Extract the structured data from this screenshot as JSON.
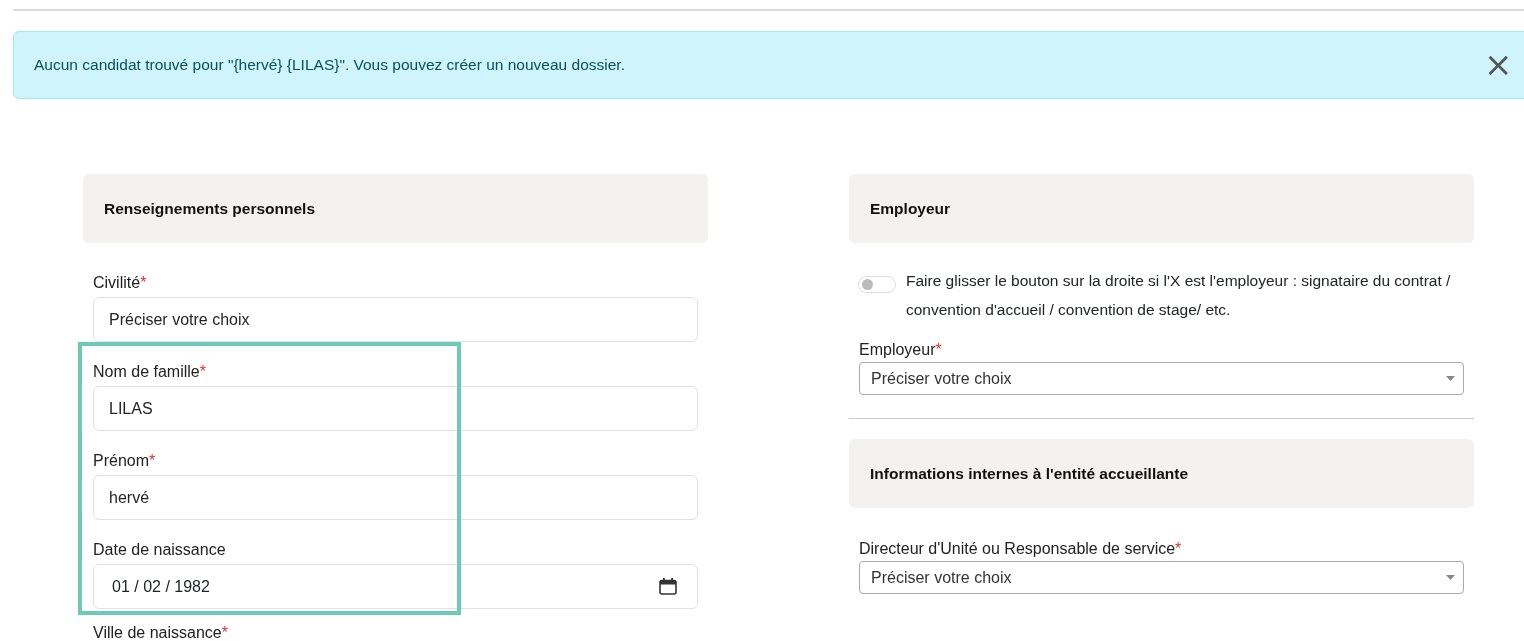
{
  "alert": {
    "message": "Aucun candidat trouvé pour \"{hervé} {LILAS}\". Vous pouvez créer un nouveau dossier.",
    "close": "×"
  },
  "required_mark": "*",
  "left": {
    "title": "Renseignements personnels",
    "fields": [
      {
        "kind": "select",
        "label": "Civilité",
        "required": true,
        "placeholder": "Préciser votre choix",
        "highlighted": false
      },
      {
        "kind": "text",
        "label": "Nom de famille",
        "required": true,
        "value": "LILAS",
        "highlighted": true
      },
      {
        "kind": "text",
        "label": "Prénom",
        "required": true,
        "value": "hervé",
        "highlighted": true
      },
      {
        "kind": "date",
        "label": "Date de naissance",
        "required": false,
        "value": "01 / 02 / 1982",
        "highlighted": true
      },
      {
        "kind": "cut",
        "label": "Ville de naissance",
        "required": true,
        "highlighted": false
      }
    ]
  },
  "right": {
    "title": "Employeur",
    "toggle": {
      "on": false,
      "label": "Faire glisser le bouton sur la droite si l'X est l'employeur : signataire du contrat / convention d'accueil / convention de stage/ etc."
    },
    "fields": [
      {
        "kind": "dropdown",
        "label": "Employeur",
        "required": true,
        "placeholder": "Préciser votre choix"
      }
    ],
    "section2_title": "Informations internes à l'entité accueillante",
    "fields2": [
      {
        "kind": "dropdown",
        "label": "Directeur d'Unité ou Responsable de service",
        "required": true,
        "placeholder": "Préciser votre choix"
      }
    ]
  }
}
